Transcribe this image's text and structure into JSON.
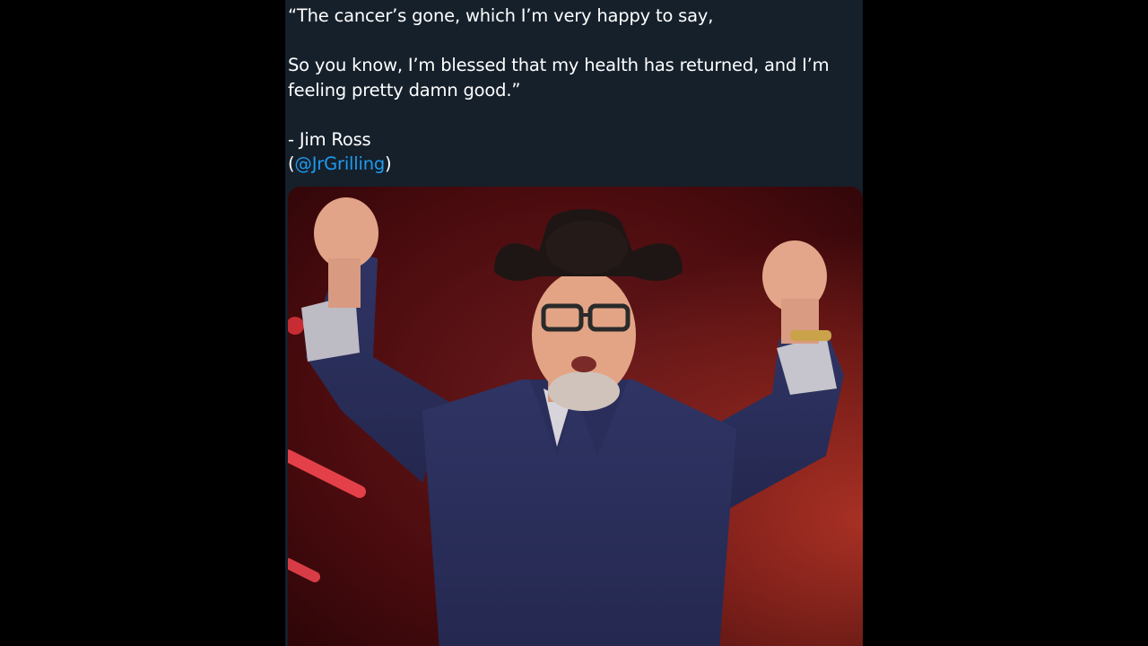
{
  "tweet": {
    "line1": "“The cancer’s gone, which I’m very happy to say,",
    "line2": "So you know, I’m blessed that my health has returned, and I’m feeling pretty damn good.”",
    "attribution": "- Jim Ross",
    "mention_open": "(",
    "mention": "@JrGrilling",
    "mention_close": ")"
  },
  "media": {
    "subject": "man-in-cowboy-hat-with-raised-fists-photo",
    "colors": {
      "background": "#5a0c10",
      "shirt": "#2c2f5e",
      "hat": "#1e1614"
    }
  },
  "colors": {
    "page_background": "#000000",
    "panel_background": "#15202b",
    "text": "#ffffff",
    "link": "#1d9bf0"
  }
}
